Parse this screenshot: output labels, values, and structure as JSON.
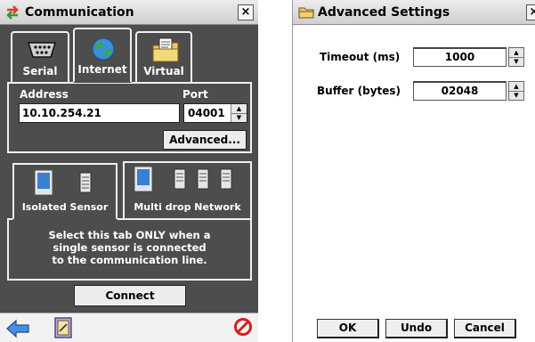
{
  "communication": {
    "title": "Communication",
    "close_label": "×",
    "tabs": [
      {
        "label": "Serial",
        "icon": "serial-port-icon"
      },
      {
        "label": "Internet",
        "icon": "globe-icon"
      },
      {
        "label": "Virtual",
        "icon": "virtual-folder-icon"
      }
    ],
    "active_tab": "Internet",
    "address_label": "Address",
    "address_value": "10.10.254.21",
    "port_label": "Port",
    "port_value": "04001",
    "advanced_button": "Advanced...",
    "mode_tabs": [
      {
        "label": "Isolated Sensor",
        "icon": "isolated-sensor-icon"
      },
      {
        "label": "Multi drop Network",
        "icon": "multidrop-network-icon"
      }
    ],
    "active_mode_tab": "Isolated Sensor",
    "description_lines": [
      "Select this tab ONLY when a",
      "single sensor is connected",
      "to the communication line."
    ],
    "connect_button": "Connect",
    "bottom_icons": [
      "back-arrow-icon",
      "notebook-icon",
      "cancel-icon"
    ],
    "colors": {
      "panel_bg": "#4d4d4d",
      "border": "#f0f0f0",
      "back_arrow": "#2f6fc0",
      "cancel": "#d42020"
    }
  },
  "advanced": {
    "title": "Advanced Settings",
    "close_label": "×",
    "timeout_label": "Timeout (ms)",
    "timeout_value": "1000",
    "buffer_label": "Buffer (bytes)",
    "buffer_value": "02048",
    "ok_button": "OK",
    "undo_button": "Undo",
    "cancel_button": "Cancel"
  }
}
